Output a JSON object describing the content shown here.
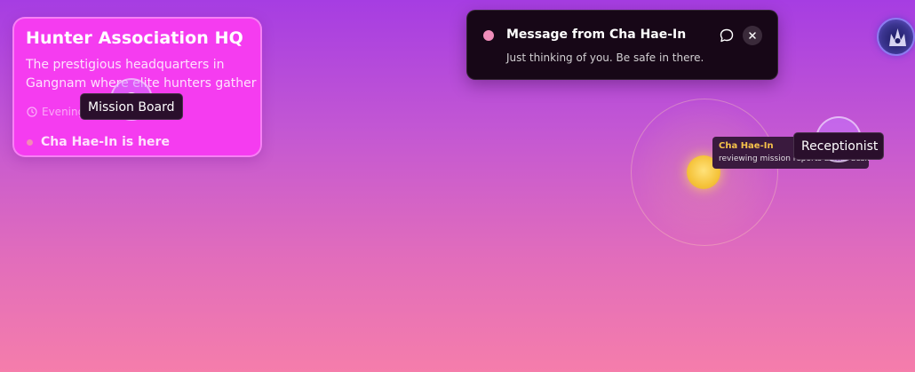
{
  "location": {
    "title": "Hunter Association HQ",
    "description": "The prestigious headquarters in Gangnam where elite hunters gather",
    "time": "Evening",
    "presence": "Cha Hae-In is here"
  },
  "hotspots": {
    "mission_board": "Mission Board",
    "receptionist": "Receptionist"
  },
  "notification": {
    "title": "Message from Cha Hae-In",
    "body": "Just thinking of you. Be safe in there.",
    "reply_icon": "chat-bubble-icon",
    "close_icon": "close-icon"
  },
  "character": {
    "name": "Cha Hae-In",
    "status": "reviewing mission reports at her desk"
  },
  "colors": {
    "card": "#f53cf0",
    "notification_bg": "#170717",
    "notif_dot": "#f08dba",
    "char_dot": "#f5c33a",
    "char_name": "#f6c24a"
  }
}
